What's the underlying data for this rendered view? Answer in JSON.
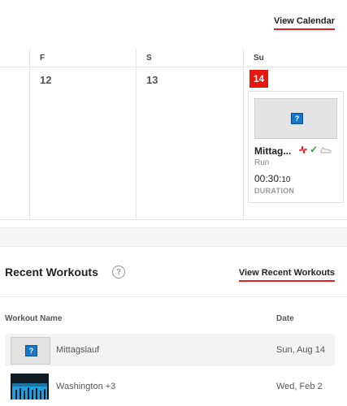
{
  "calendar": {
    "view_link": "View Calendar",
    "days": [
      {
        "header": "F",
        "number": "12"
      },
      {
        "header": "S",
        "number": "13"
      },
      {
        "header": "Su",
        "number": "14"
      }
    ],
    "workout_card": {
      "title": "Mittag...",
      "type": "Run",
      "duration_main": "00:30:",
      "duration_small": "10",
      "duration_label": "DURATION",
      "thumbnail_icon": "question-icon",
      "status_icons": [
        "heart-rate-icon",
        "check-icon",
        "shoe-icon"
      ],
      "thumbnail_icon_glyph": "?",
      "check_glyph": "✓"
    }
  },
  "recent_workouts": {
    "title": "Recent Workouts",
    "help_glyph": "?",
    "view_link": "View Recent Workouts",
    "columns": {
      "name": "Workout Name",
      "date": "Date"
    },
    "rows": [
      {
        "name": "Mittagslauf",
        "date": "Sun, Aug 14",
        "thumbnail": "placeholder-icon",
        "thumbnail_glyph": "?"
      },
      {
        "name": "Washington +3",
        "date": "Wed, Feb 2",
        "thumbnail": "map-thumbnail"
      }
    ]
  },
  "colors": {
    "accent": "#e8160c",
    "link_underline": "#e02020",
    "check": "#2a9d2a",
    "map_bars": "#1ea0e0"
  }
}
